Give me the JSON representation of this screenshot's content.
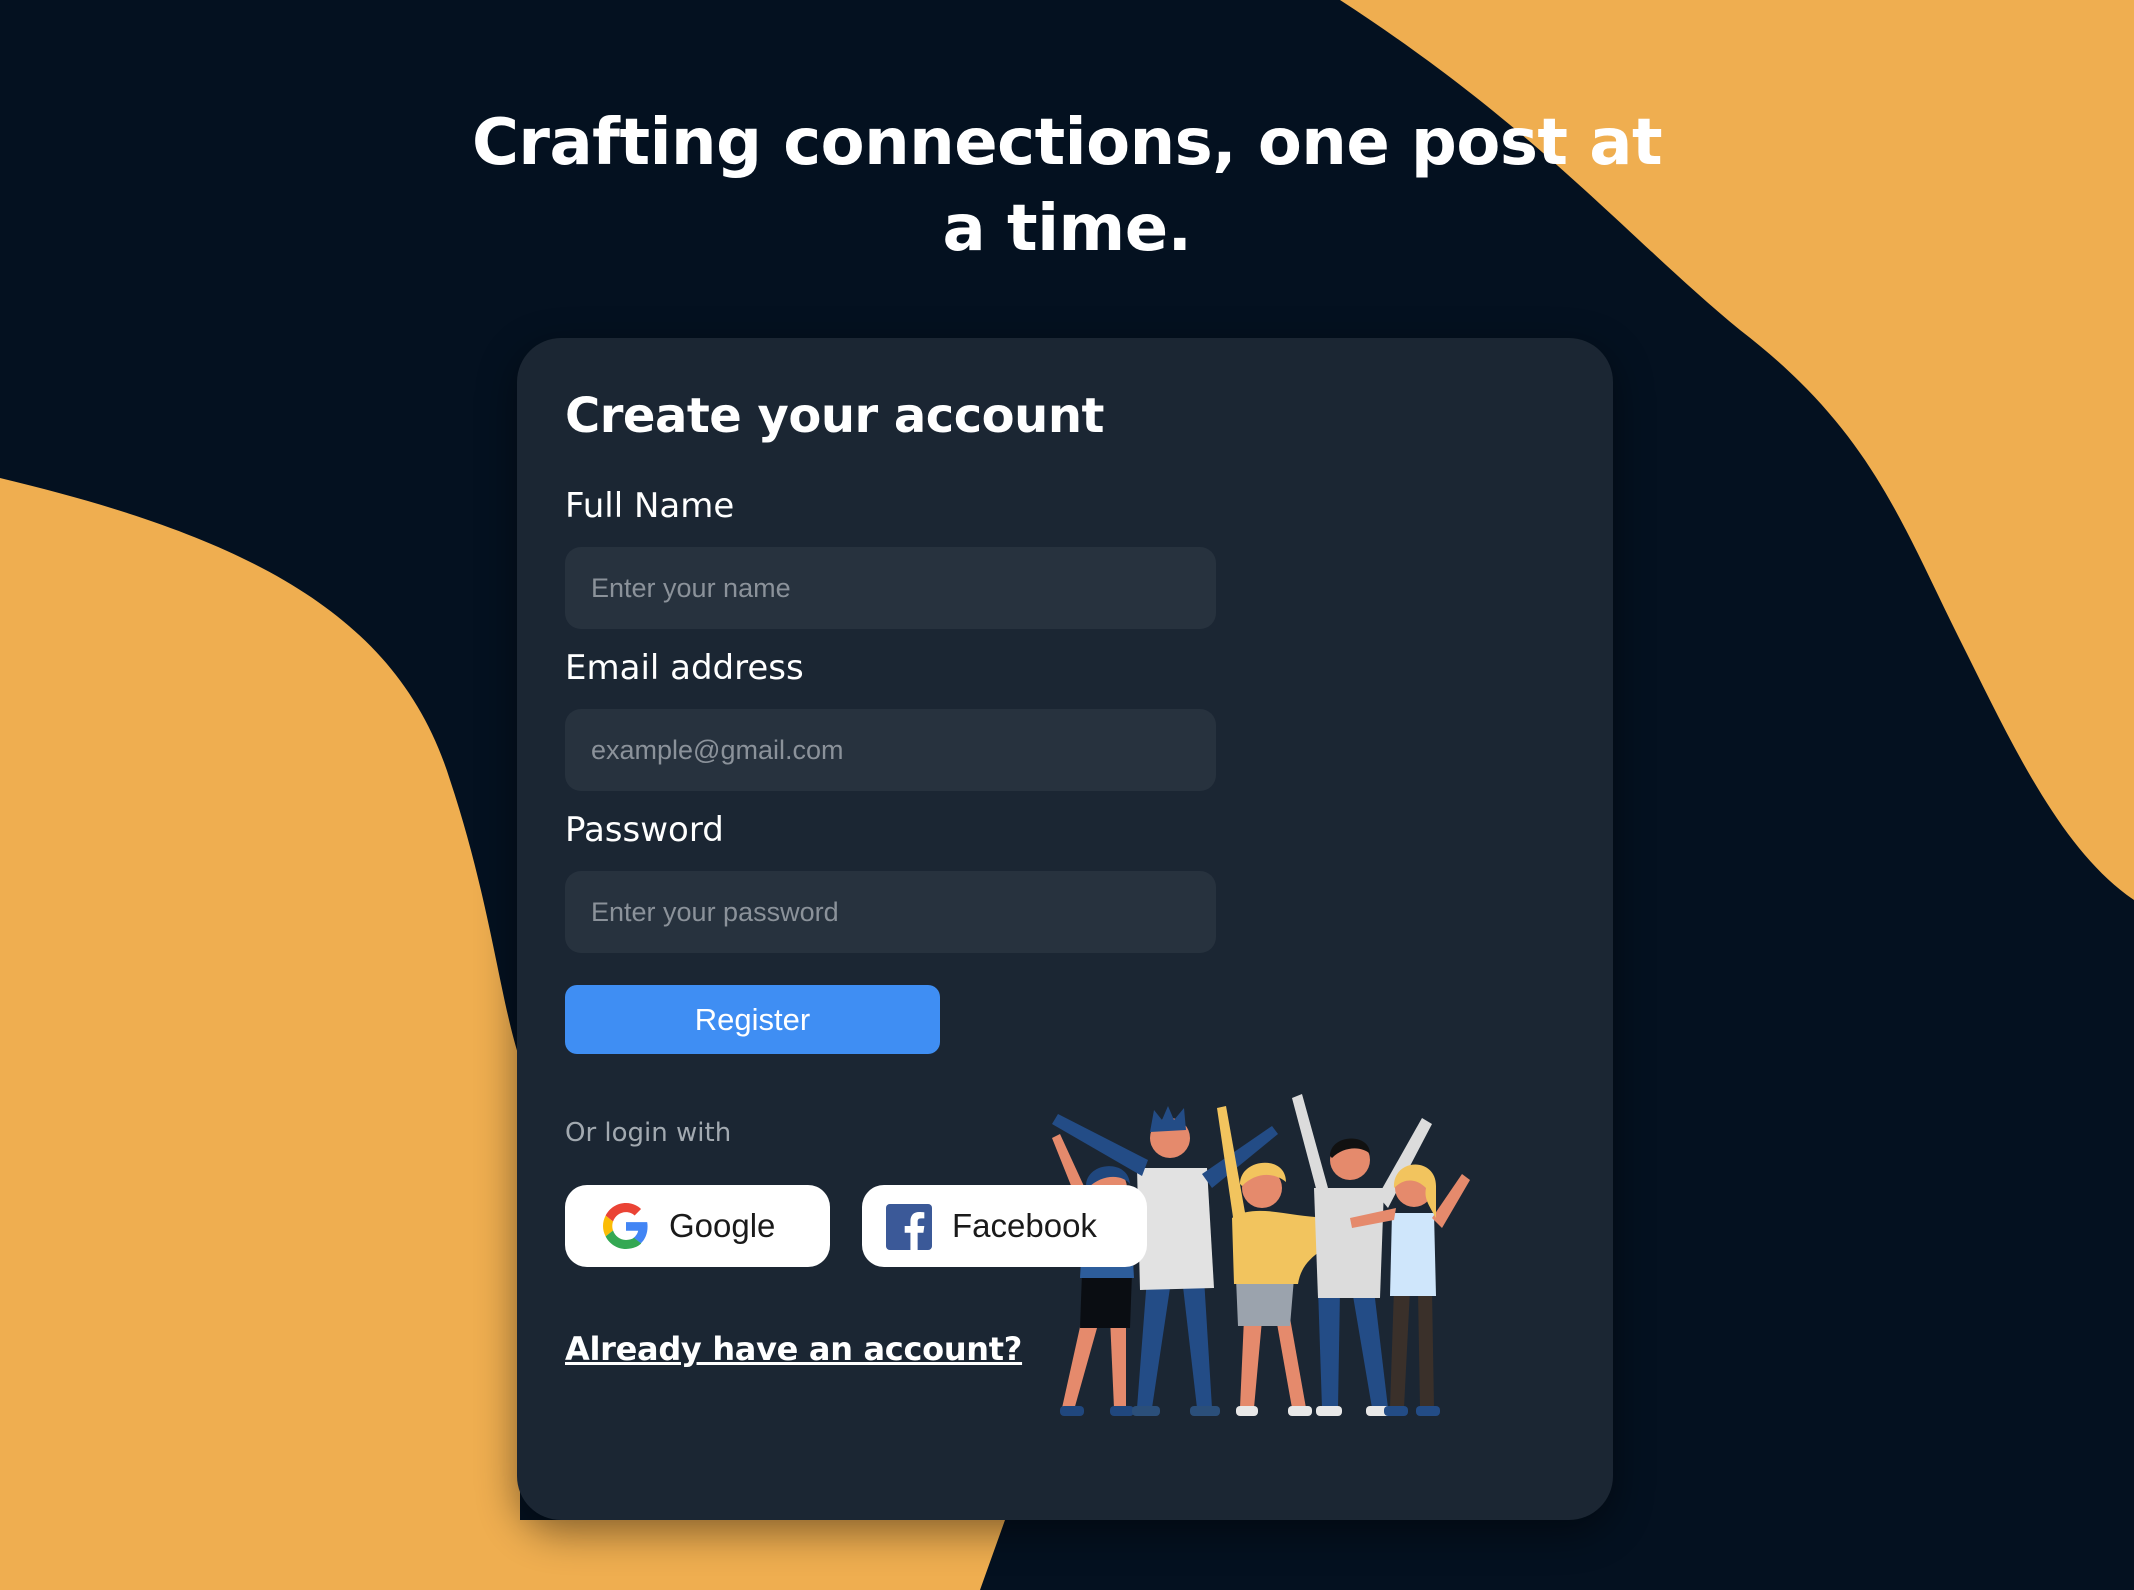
{
  "headline": "Crafting connections, one post at a time.",
  "form": {
    "title": "Create your account",
    "fields": [
      {
        "label": "Full Name",
        "placeholder": "Enter your name",
        "value": ""
      },
      {
        "label": "Email address",
        "placeholder": "example@gmail.com",
        "value": ""
      },
      {
        "label": "Password",
        "placeholder": "Enter your password",
        "value": ""
      }
    ],
    "register_label": "Register",
    "or_login_label": "Or login with",
    "social": [
      {
        "label": "Google",
        "icon": "google-icon"
      },
      {
        "label": "Facebook",
        "icon": "facebook-icon"
      }
    ],
    "already_link": "Already have an account?"
  },
  "illustration": {
    "icon": "people-celebrating-illustration"
  },
  "colors": {
    "background": "#041120",
    "accent_blob": "#efae50",
    "card": "#1b2633",
    "input": "#27323e",
    "primary_button": "#3f8ef3"
  }
}
